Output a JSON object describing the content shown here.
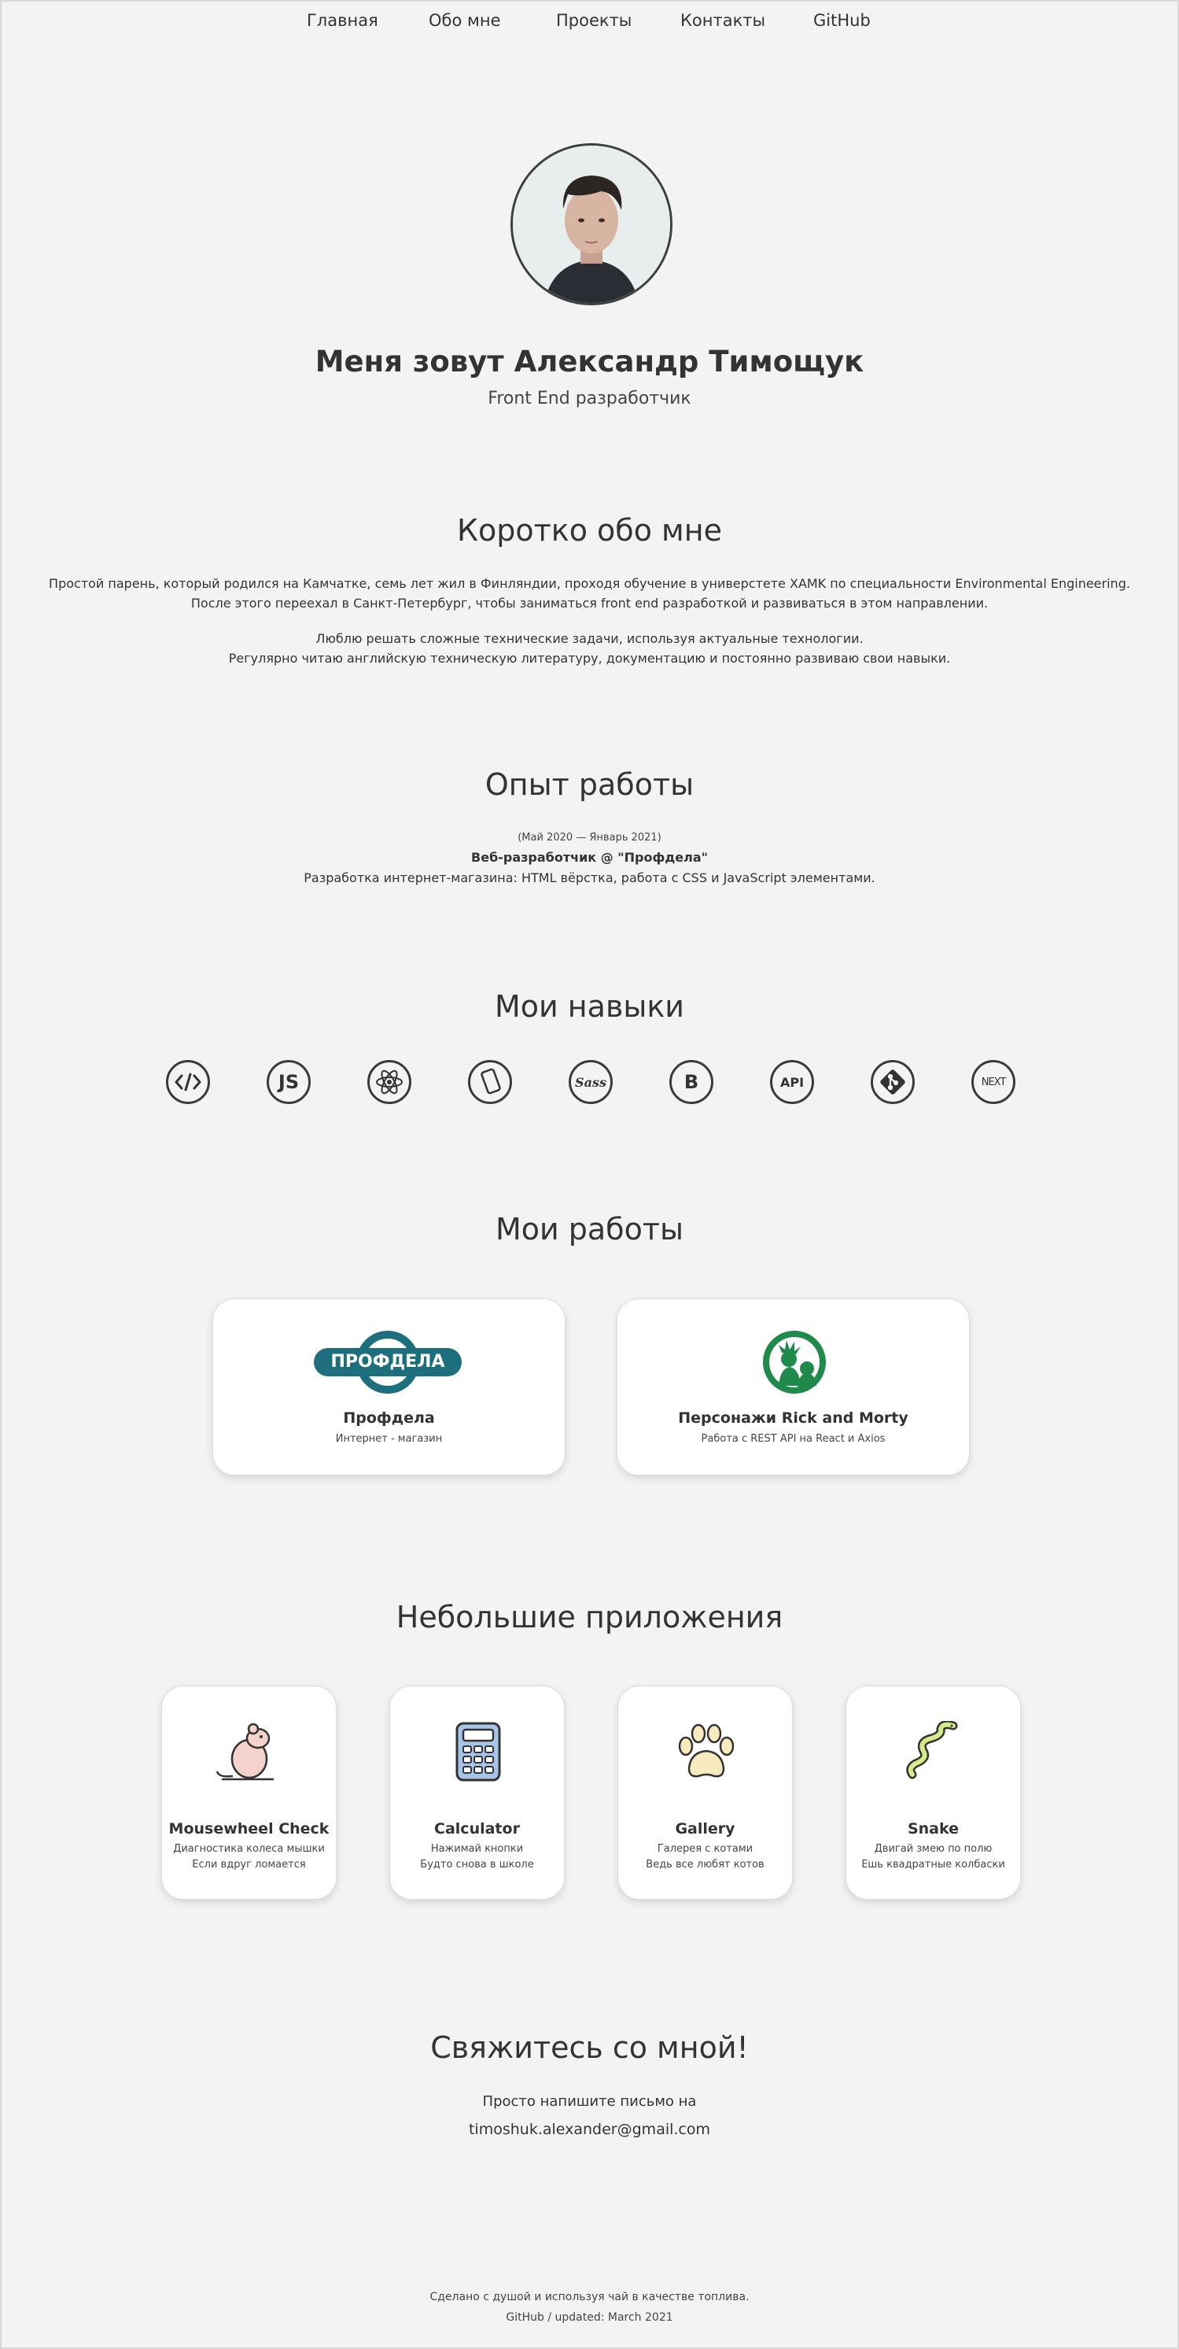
{
  "nav": {
    "home": "Главная",
    "about": "Обо мне",
    "projects": "Проекты",
    "contacts": "Контакты",
    "github": "GitHub"
  },
  "hero": {
    "name": "Меня зовут Александр Тимощук",
    "role": "Front End разработчик"
  },
  "about": {
    "title": "Коротко обо мне",
    "p1_line1": "Простой парень, который родился на Камчатке, семь лет жил в Финляндии, проходя обучение в универстете XAMK по специальности Environmental Engineering.",
    "p1_line2": "После этого переехал в Санкт-Петербург, чтобы заниматься front end разработкой и развиваться в этом направлении.",
    "p2_line1": "Люблю решать сложные технические задачи, используя актуальные технологии.",
    "p2_line2": "Регулярно читаю английскую техническую литературу, документацию и постоянно развиваю свои навыки."
  },
  "experience": {
    "title": "Опыт работы",
    "period": "(Май 2020 — Январь 2021)",
    "position": "Веб-разработчик @ \"Профдела\"",
    "description": "Разработка интернет-магазина: HTML вёрстка, работа с CSS и JavaScript элементами."
  },
  "skills": {
    "title": "Мои навыки",
    "items": [
      {
        "icon": "html-code-icon",
        "label": "</>"
      },
      {
        "icon": "javascript-icon",
        "label": "JS"
      },
      {
        "icon": "react-icon",
        "label": "⚛"
      },
      {
        "icon": "mobile-icon",
        "label": "▯"
      },
      {
        "icon": "sass-icon",
        "label": "Sass"
      },
      {
        "icon": "bootstrap-icon",
        "label": "B"
      },
      {
        "icon": "api-icon",
        "label": "API"
      },
      {
        "icon": "git-icon",
        "label": "◆"
      },
      {
        "icon": "nextjs-icon",
        "label": "NEXT"
      }
    ]
  },
  "works": {
    "title": "Мои работы",
    "items": [
      {
        "logo": "ПРОФДЕЛА",
        "title": "Профдела",
        "subtitle": "Интернет - магазин"
      },
      {
        "title": "Персонажи Rick and Morty",
        "subtitle": "Работа с REST API на React и Axios"
      }
    ]
  },
  "apps": {
    "title": "Небольшие приложения",
    "items": [
      {
        "icon": "mouse-icon",
        "title": "Mousewheel Check",
        "line1": "Диагностика колеса мышки",
        "line2": "Если вдруг ломается"
      },
      {
        "icon": "calculator-icon",
        "title": "Calculator",
        "line1": "Нажимай кнопки",
        "line2": "Будто снова в школе"
      },
      {
        "icon": "paw-icon",
        "title": "Gallery",
        "line1": "Галерея с котами",
        "line2": "Ведь все любят котов"
      },
      {
        "icon": "snake-icon",
        "title": "Snake",
        "line1": "Двигай змею по полю",
        "line2": "Ешь квадратные колбаски"
      }
    ]
  },
  "contact": {
    "title": "Свяжитесь со мной!",
    "text": "Просто напишите письмо на",
    "email": "timoshuk.alexander@gmail.com"
  },
  "footer": {
    "line1": "Сделано с душой и используя чай в качестве топлива.",
    "line2": "GitHub / updated: March 2021"
  },
  "colors": {
    "background": "#f3f3f4",
    "text": "#333333",
    "profdela_teal": "#1e6f7d",
    "rick_green": "#1f8a4c"
  }
}
